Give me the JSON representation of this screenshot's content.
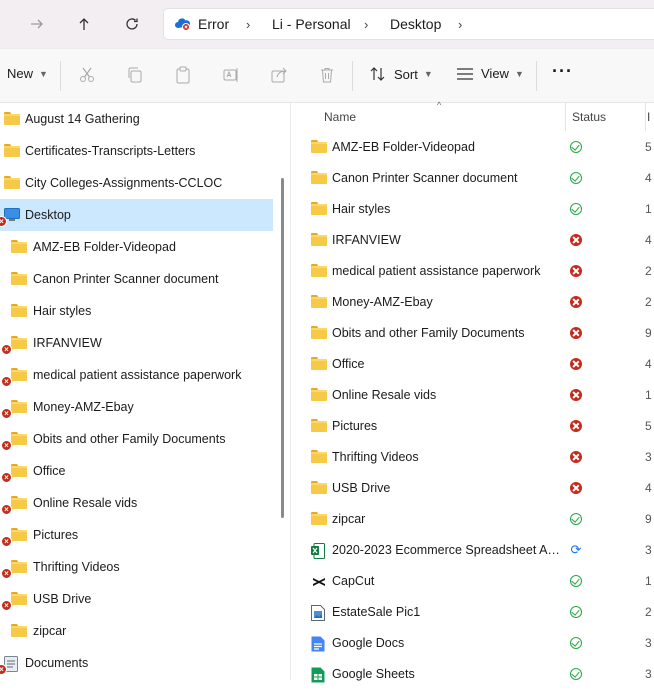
{
  "nav": {
    "back_icon": "arrow-right-icon",
    "up_icon": "arrow-up-icon",
    "refresh_icon": "refresh-icon"
  },
  "address": {
    "segments": [
      "Error",
      "Li - Personal",
      "Desktop"
    ]
  },
  "toolbar": {
    "new_label": "New",
    "sort_label": "Sort",
    "view_label": "View",
    "more_label": "···"
  },
  "sidebar": {
    "items": [
      {
        "label": "August 14 Gathering",
        "indent": 0,
        "error": false,
        "selected": false
      },
      {
        "label": "Certificates-Transcripts-Letters",
        "indent": 0,
        "error": false,
        "selected": false
      },
      {
        "label": "City Colleges-Assignments-CCLOC",
        "indent": 0,
        "error": false,
        "selected": false
      },
      {
        "label": "Desktop",
        "indent": 0,
        "error": true,
        "selected": true
      },
      {
        "label": "AMZ-EB Folder-Videopad",
        "indent": 1,
        "error": false,
        "selected": false
      },
      {
        "label": "Canon Printer Scanner document",
        "indent": 1,
        "error": false,
        "selected": false
      },
      {
        "label": "Hair styles",
        "indent": 1,
        "error": false,
        "selected": false
      },
      {
        "label": "IRFANVIEW",
        "indent": 1,
        "error": true,
        "selected": false
      },
      {
        "label": "medical patient assistance paperwork",
        "indent": 1,
        "error": true,
        "selected": false
      },
      {
        "label": "Money-AMZ-Ebay",
        "indent": 1,
        "error": true,
        "selected": false
      },
      {
        "label": "Obits and other Family Documents",
        "indent": 1,
        "error": true,
        "selected": false
      },
      {
        "label": "Office",
        "indent": 1,
        "error": true,
        "selected": false
      },
      {
        "label": "Online Resale vids",
        "indent": 1,
        "error": true,
        "selected": false
      },
      {
        "label": "Pictures",
        "indent": 1,
        "error": true,
        "selected": false
      },
      {
        "label": "Thrifting Videos",
        "indent": 1,
        "error": true,
        "selected": false
      },
      {
        "label": "USB Drive",
        "indent": 1,
        "error": true,
        "selected": false
      },
      {
        "label": "zipcar",
        "indent": 1,
        "error": false,
        "selected": false
      },
      {
        "label": "Documents",
        "indent": 0,
        "error": true,
        "selected": false
      }
    ]
  },
  "columns": {
    "name": "Name",
    "status": "Status"
  },
  "files": [
    {
      "name": "AMZ-EB Folder-Videopad",
      "icon": "folder-icon",
      "status": "ok",
      "cut": "5"
    },
    {
      "name": "Canon Printer Scanner document",
      "icon": "folder-icon",
      "status": "ok",
      "cut": "4"
    },
    {
      "name": "Hair styles",
      "icon": "folder-icon",
      "status": "ok",
      "cut": "1"
    },
    {
      "name": "IRFANVIEW",
      "icon": "folder-icon",
      "status": "err",
      "cut": "4"
    },
    {
      "name": "medical patient assistance paperwork",
      "icon": "folder-icon",
      "status": "err",
      "cut": "2"
    },
    {
      "name": "Money-AMZ-Ebay",
      "icon": "folder-icon",
      "status": "err",
      "cut": "2"
    },
    {
      "name": "Obits and other Family Documents",
      "icon": "folder-icon",
      "status": "err",
      "cut": "9"
    },
    {
      "name": "Office",
      "icon": "folder-icon",
      "status": "err",
      "cut": "4"
    },
    {
      "name": "Online Resale vids",
      "icon": "folder-icon",
      "status": "err",
      "cut": "1"
    },
    {
      "name": "Pictures",
      "icon": "folder-icon",
      "status": "err",
      "cut": "5"
    },
    {
      "name": "Thrifting Videos",
      "icon": "folder-icon",
      "status": "err",
      "cut": "3"
    },
    {
      "name": "USB Drive",
      "icon": "folder-icon",
      "status": "err",
      "cut": "4"
    },
    {
      "name": "zipcar",
      "icon": "folder-icon",
      "status": "ok",
      "cut": "9"
    },
    {
      "name": "2020-2023 Ecommerce Spreadsheet AMZ...",
      "icon": "excel-icon",
      "status": "sync",
      "cut": "3"
    },
    {
      "name": "CapCut",
      "icon": "capcut-icon",
      "status": "ok",
      "cut": "1"
    },
    {
      "name": "EstateSale Pic1",
      "icon": "image-file-icon",
      "status": "ok",
      "cut": "2"
    },
    {
      "name": "Google Docs",
      "icon": "google-docs-icon",
      "status": "ok",
      "cut": "3"
    },
    {
      "name": "Google Sheets",
      "icon": "google-sheets-icon",
      "status": "ok",
      "cut": "3"
    }
  ],
  "colors": {
    "selection": "#cce8ff",
    "error_red": "#c42b1c",
    "ok_green": "#28a745",
    "sync_blue": "#1a73e8",
    "folder_yellow": "#f7c948"
  }
}
